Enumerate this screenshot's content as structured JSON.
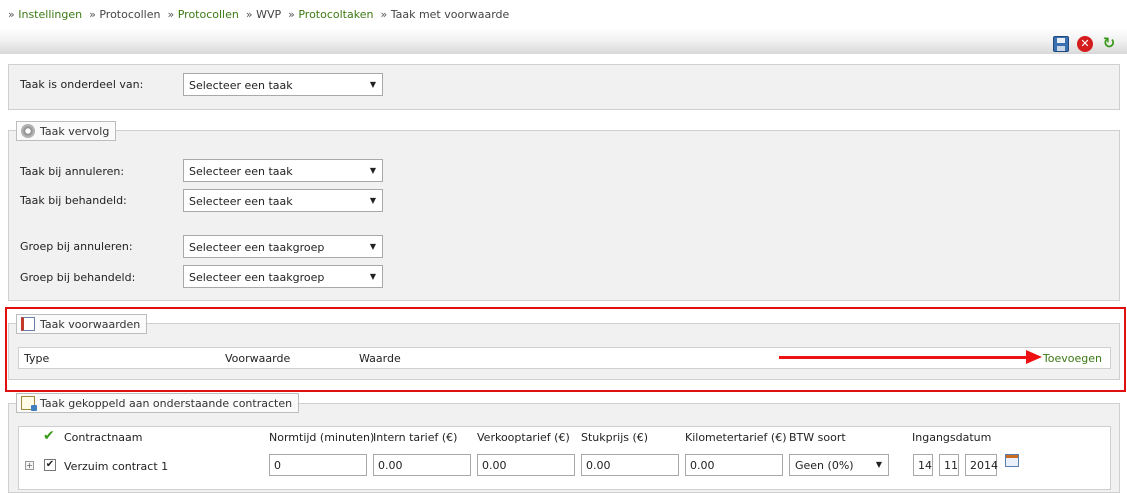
{
  "breadcrumb": {
    "items": [
      {
        "label": "Instellingen",
        "link": true
      },
      {
        "label": "Protocollen",
        "link": false
      },
      {
        "label": "Protocollen",
        "link": true
      },
      {
        "label": "WVP",
        "link": false
      },
      {
        "label": "Protocoltaken",
        "link": true
      },
      {
        "label": "Taak met voorwaarde",
        "link": false
      }
    ],
    "separator": "»"
  },
  "toolbar": {
    "icons": [
      "save-icon",
      "close-icon",
      "refresh-icon"
    ],
    "close_glyph": "✕",
    "refresh_glyph": "↻"
  },
  "parent": {
    "label": "Taak is onderdeel van:",
    "value": "Selecteer een taak"
  },
  "vervolg": {
    "legend": "Taak vervolg",
    "rows": [
      {
        "label": "Taak bij annuleren:",
        "value": "Selecteer een taak"
      },
      {
        "label": "Taak bij behandeld:",
        "value": "Selecteer een taak"
      },
      {
        "label": "Groep bij annuleren:",
        "value": "Selecteer een taakgroep"
      },
      {
        "label": "Groep bij behandeld:",
        "value": "Selecteer een taakgroep"
      }
    ]
  },
  "voorwaarden": {
    "legend": "Taak voorwaarden",
    "columns": [
      "Type",
      "Voorwaarde",
      "Waarde"
    ],
    "add_label": "Toevoegen"
  },
  "contracten": {
    "legend": "Taak gekoppeld aan onderstaande contracten",
    "columns": [
      "Contractnaam",
      "Normtijd (minuten)",
      "Intern tarief (€)",
      "Verkooptarief (€)",
      "Stukprijs (€)",
      "Kilometertarief (€)",
      "BTW soort",
      "Ingangsdatum"
    ],
    "rows": [
      {
        "name": "Verzuim contract 1",
        "checked": true,
        "normtijd": "0",
        "intern": "0.00",
        "verkoop": "0.00",
        "stuk": "0.00",
        "km": "0.00",
        "btw": "Geen (0%)",
        "day": "14",
        "month": "11",
        "year": "2014"
      }
    ]
  },
  "colors": {
    "link": "#3c7a14",
    "highlight": "#e01010",
    "panel_bg": "#f1f1f1"
  }
}
